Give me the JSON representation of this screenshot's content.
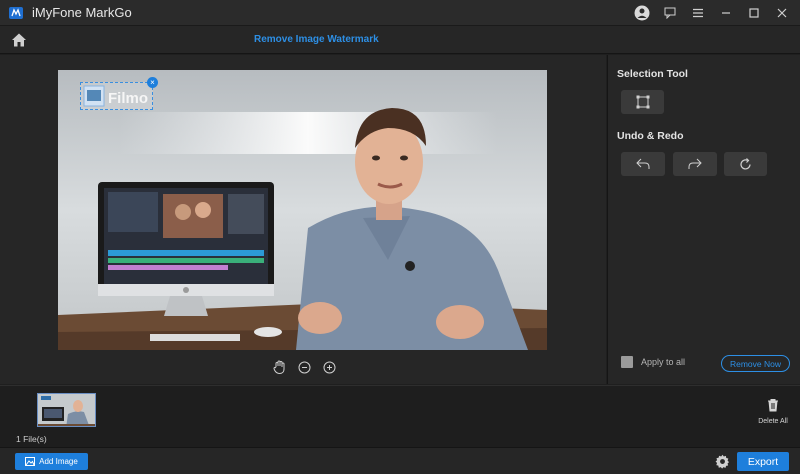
{
  "window": {
    "title": "iMyFone MarkGo"
  },
  "titlebar_icons": [
    "user-account-icon",
    "feedback-icon",
    "menu-icon",
    "minimize-icon",
    "maximize-icon",
    "close-icon"
  ],
  "nav": {
    "page_title": "Remove Image Watermark"
  },
  "canvas": {
    "watermark_text": "Filmo"
  },
  "zoom_tools": [
    "hand-icon",
    "zoom-out-icon",
    "zoom-in-icon"
  ],
  "right_panel": {
    "selection_tool_label": "Selection Tool",
    "undo_redo_label": "Undo & Redo",
    "apply_to_all_label": "Apply to all",
    "remove_now_label": "Remove Now"
  },
  "files": {
    "count_label": "1 File(s)",
    "delete_all_label": "Delete All"
  },
  "bottom": {
    "add_image_label": "Add Image",
    "export_label": "Export"
  },
  "colors": {
    "accent": "#1e7fdc",
    "title_blue": "#2d8fe5",
    "panel_bg": "#262626"
  }
}
